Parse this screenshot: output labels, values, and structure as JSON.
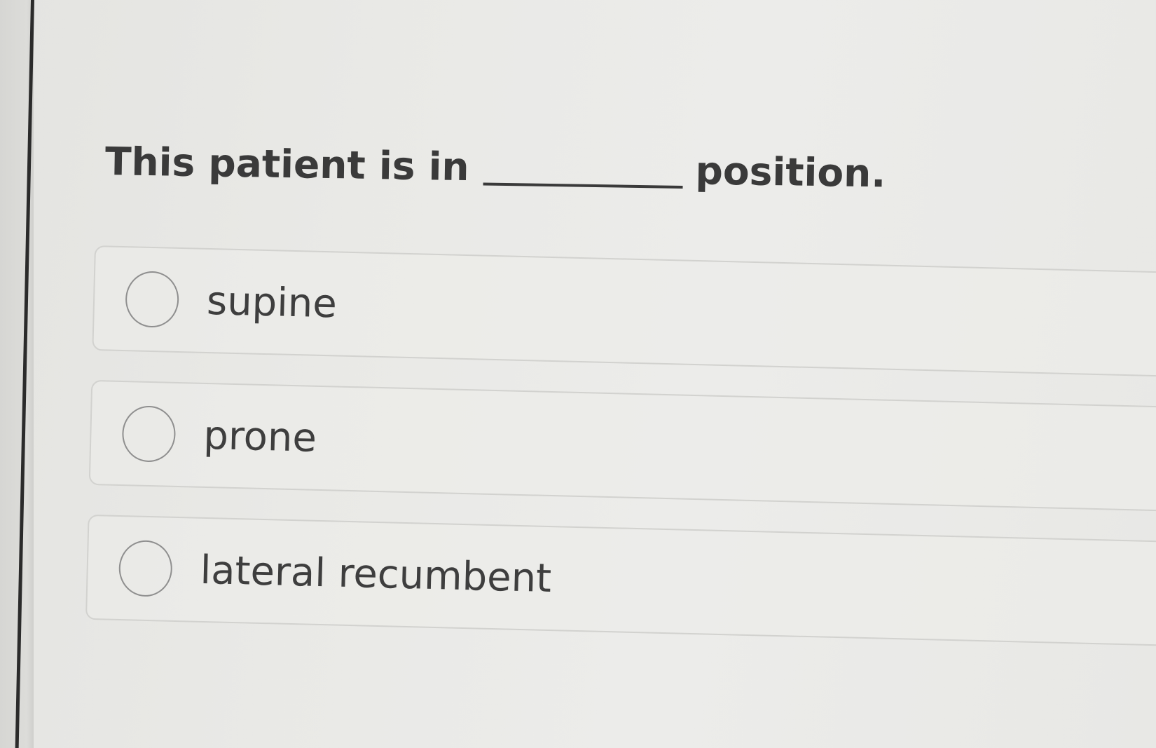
{
  "question": {
    "prefix": "This patient is in",
    "suffix": "position."
  },
  "options": [
    {
      "label": "supine",
      "selected": false
    },
    {
      "label": "prone",
      "selected": false
    },
    {
      "label": "lateral recumbent",
      "selected": false
    }
  ],
  "colors": {
    "background": "#e9e9e6",
    "text": "#3c3c3c",
    "option_border": "#d2d2cf",
    "radio_border": "#8f8f8f"
  }
}
